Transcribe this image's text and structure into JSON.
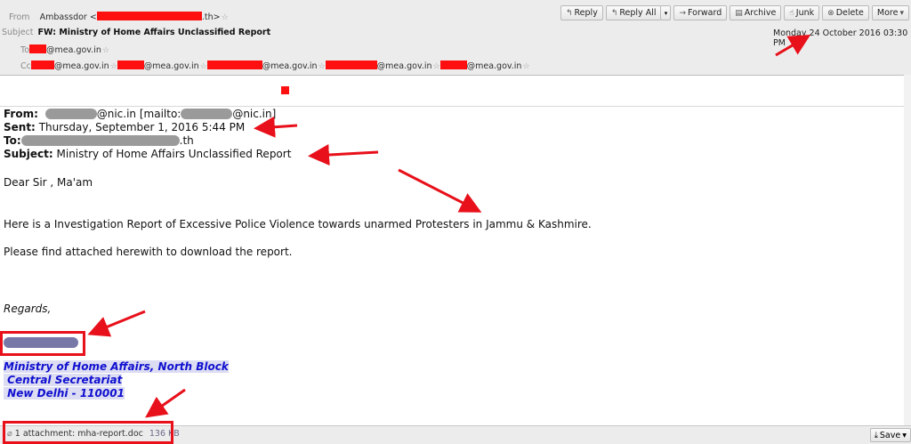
{
  "header": {
    "from_label": "From",
    "from_name": "Ambassdor",
    "from_domain_suffix": ".th>",
    "subject_label": "Subject",
    "subject": "FW: Ministry of Home Affairs Unclassified Report",
    "to_label": "To",
    "to_domain": "@mea.gov.in",
    "cc_label": "Cc",
    "cc_domain": "@mea.gov.in",
    "date": "Monday 24 October 2016 03:30 PM"
  },
  "toolbar": {
    "reply": "Reply",
    "reply_all": "Reply All",
    "forward": "Forward",
    "archive": "Archive",
    "junk": "Junk",
    "delete": "Delete",
    "more": "More"
  },
  "message": {
    "from_label": "From:",
    "from_domain": "@nic.in [mailto:",
    "from_domain_end": "@nic.in]",
    "sent_label": "Sent:",
    "sent": "Thursday, September 1, 2016 5:44 PM",
    "to_label": "To:",
    "to_suffix": ".th",
    "subject_label": "Subject:",
    "subject": "Ministry of Home Affairs Unclassified Report",
    "greeting": "Dear Sir , Ma'am",
    "para1": "Here is a Investigation Report of Excessive Police Violence towards unarmed Protesters in Jammu & Kashmire.",
    "para2": "Please find attached herewith to download the report.",
    "regards": "Regards,",
    "sig1": "Ministry of Home Affairs, North Block",
    "sig2": " Central Secretariat",
    "sig3": " New Delhi - 110001"
  },
  "attachment": {
    "label": "1 attachment: mha-report.doc",
    "size": "136 KB",
    "save": "Save"
  },
  "colors": {
    "redaction": "#ff1010",
    "annotation": "#e8101a",
    "signature": "#1010d0"
  }
}
